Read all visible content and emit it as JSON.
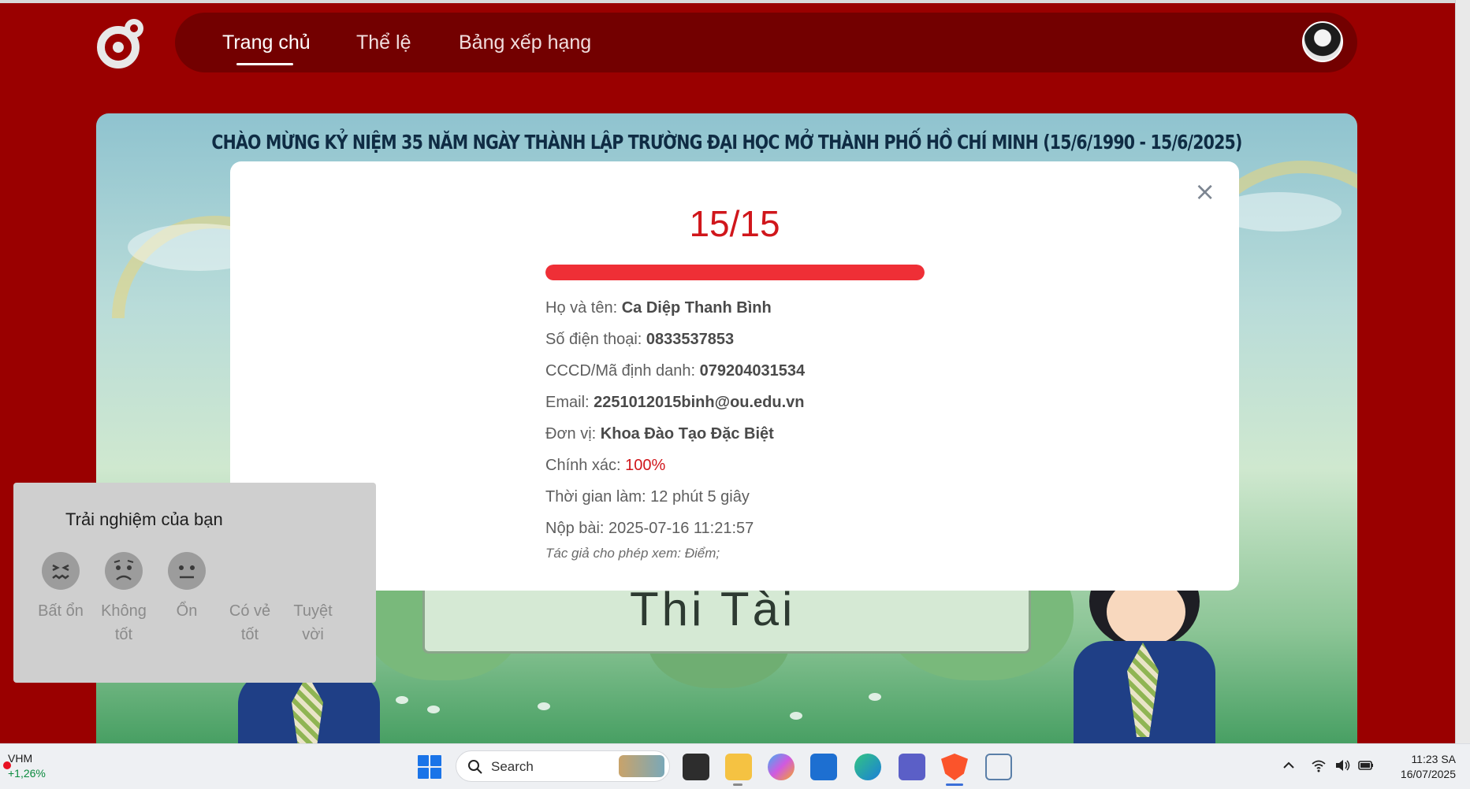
{
  "nav": {
    "items": [
      "Trang chủ",
      "Thể lệ",
      "Bảng xếp hạng"
    ],
    "active": "Trang chủ"
  },
  "banner": {
    "title": "CHÀO MỪNG KỶ NIỆM 35 NĂM NGÀY THÀNH LẬP TRƯỜNG ĐẠI HỌC MỞ THÀNH PHỐ HỒ CHÍ MINH (15/6/1990 - 15/6/2025)",
    "sign_text": "Thi Tài"
  },
  "result_modal": {
    "score": "15/15",
    "progress_fraction": 1.0,
    "rows": {
      "name_label": "Họ và tên: ",
      "name_value": "Ca Diệp Thanh Bình",
      "phone_label": "Số điện thoại: ",
      "phone_value": "0833537853",
      "id_label": "CCCD/Mã định danh: ",
      "id_value": "079204031534",
      "email_label": "Email: ",
      "email_value": "2251012015binh@ou.edu.vn",
      "unit_label": "Đơn vị: ",
      "unit_value": "Khoa Đào Tạo Đặc Biệt",
      "accuracy_label": "Chính xác: ",
      "accuracy_value": "100%",
      "duration": "Thời gian làm: 12 phút 5 giây",
      "submitted": "Nộp bài: 2025-07-16 11:21:57"
    },
    "permission_note": "Tác giả cho phép xem: Điểm;",
    "close_symbol": "×"
  },
  "feedback": {
    "title": "Trải nghiệm của bạn",
    "options": [
      "Bất ổn",
      "Không tốt",
      "Ổn",
      "Có vẻ tốt",
      "Tuyệt vời"
    ]
  },
  "taskbar": {
    "stock_symbol": "VHM",
    "stock_change": "+1,26%",
    "search_label": "Search",
    "time": "11:23 SA",
    "date": "16/07/2025"
  },
  "colors": {
    "page_background": "#9a0000",
    "navbar": "#730000",
    "score_red": "#d0161b",
    "progress_red": "#ef2f36"
  }
}
